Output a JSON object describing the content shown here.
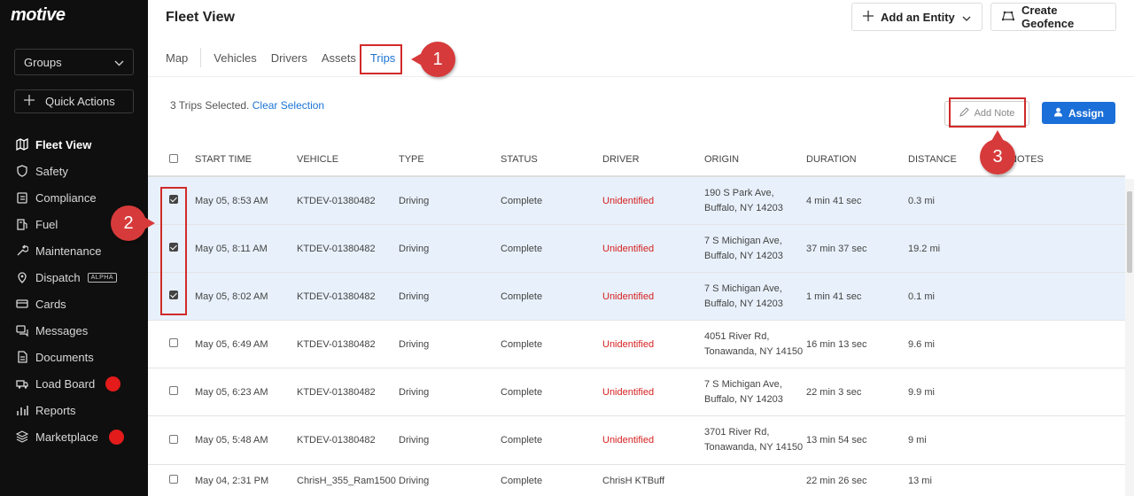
{
  "brand": {
    "logo": "motive"
  },
  "sidebar": {
    "groups_label": "Groups",
    "quick_actions_label": "Quick Actions",
    "items": [
      {
        "label": "Fleet View",
        "icon": "map-icon",
        "active": true
      },
      {
        "label": "Safety",
        "icon": "shield-icon"
      },
      {
        "label": "Compliance",
        "icon": "clipboard-icon"
      },
      {
        "label": "Fuel",
        "icon": "fuel-icon"
      },
      {
        "label": "Maintenance",
        "icon": "wrench-icon"
      },
      {
        "label": "Dispatch",
        "icon": "location-pin-icon",
        "badge": "ALPHA"
      },
      {
        "label": "Cards",
        "icon": "card-icon"
      },
      {
        "label": "Messages",
        "icon": "chat-icon"
      },
      {
        "label": "Documents",
        "icon": "document-icon"
      },
      {
        "label": "Load Board",
        "icon": "truck-icon",
        "dot": true
      },
      {
        "label": "Reports",
        "icon": "bar-chart-icon"
      },
      {
        "label": "Marketplace",
        "icon": "layers-icon",
        "dot": true
      }
    ]
  },
  "header": {
    "title": "Fleet View",
    "add_entity_label": "Add an Entity",
    "create_geofence_label": "Create Geofence"
  },
  "tabs": [
    "Map",
    "Vehicles",
    "Drivers",
    "Assets",
    "Trips"
  ],
  "active_tab": "Trips",
  "selection": {
    "text": "3 Trips Selected.",
    "clear_label": "Clear Selection",
    "add_note_label": "Add Note",
    "assign_label": "Assign"
  },
  "table": {
    "columns": [
      "START TIME",
      "VEHICLE",
      "TYPE",
      "STATUS",
      "DRIVER",
      "ORIGIN",
      "DURATION",
      "DISTANCE",
      "NOTES"
    ],
    "rows": [
      {
        "checked": true,
        "start": "May 05, 8:53 AM",
        "vehicle": "KTDEV-01380482",
        "type": "Driving",
        "status": "Complete",
        "driver": "Unidentified",
        "origin1": "190 S Park Ave,",
        "origin2": "Buffalo, NY 14203",
        "duration": "4 min 41 sec",
        "distance": "0.3 mi",
        "notes": ""
      },
      {
        "checked": true,
        "start": "May 05, 8:11 AM",
        "vehicle": "KTDEV-01380482",
        "type": "Driving",
        "status": "Complete",
        "driver": "Unidentified",
        "origin1": "7 S Michigan Ave,",
        "origin2": "Buffalo, NY 14203",
        "duration": "37 min 37 sec",
        "distance": "19.2 mi",
        "notes": ""
      },
      {
        "checked": true,
        "start": "May 05, 8:02 AM",
        "vehicle": "KTDEV-01380482",
        "type": "Driving",
        "status": "Complete",
        "driver": "Unidentified",
        "origin1": "7 S Michigan Ave,",
        "origin2": "Buffalo, NY 14203",
        "duration": "1 min 41 sec",
        "distance": "0.1 mi",
        "notes": ""
      },
      {
        "checked": false,
        "start": "May 05, 6:49 AM",
        "vehicle": "KTDEV-01380482",
        "type": "Driving",
        "status": "Complete",
        "driver": "Unidentified",
        "origin1": "4051 River Rd,",
        "origin2": "Tonawanda, NY 14150",
        "duration": "16 min 13 sec",
        "distance": "9.6 mi",
        "notes": ""
      },
      {
        "checked": false,
        "start": "May 05, 6:23 AM",
        "vehicle": "KTDEV-01380482",
        "type": "Driving",
        "status": "Complete",
        "driver": "Unidentified",
        "origin1": "7 S Michigan Ave,",
        "origin2": "Buffalo, NY 14203",
        "duration": "22 min 3 sec",
        "distance": "9.9 mi",
        "notes": ""
      },
      {
        "checked": false,
        "start": "May 05, 5:48 AM",
        "vehicle": "KTDEV-01380482",
        "type": "Driving",
        "status": "Complete",
        "driver": "Unidentified",
        "origin1": "3701 River Rd,",
        "origin2": "Tonawanda, NY 14150",
        "duration": "13 min 54 sec",
        "distance": "9 mi",
        "notes": ""
      },
      {
        "checked": false,
        "start": "May 04, 2:31 PM",
        "vehicle": "ChrisH_355_Ram1500",
        "type": "Driving",
        "status": "Complete",
        "driver": "ChrisH KTBuff",
        "origin1": "",
        "origin2": "",
        "duration": "22 min 26 sec",
        "distance": "13 mi",
        "notes": ""
      }
    ]
  },
  "annotations": {
    "step1": "1",
    "step2": "2",
    "step3": "3"
  },
  "colors": {
    "accent": "#1b74d6",
    "annotation": "#d12a2a",
    "unidentified": "#d62020"
  }
}
